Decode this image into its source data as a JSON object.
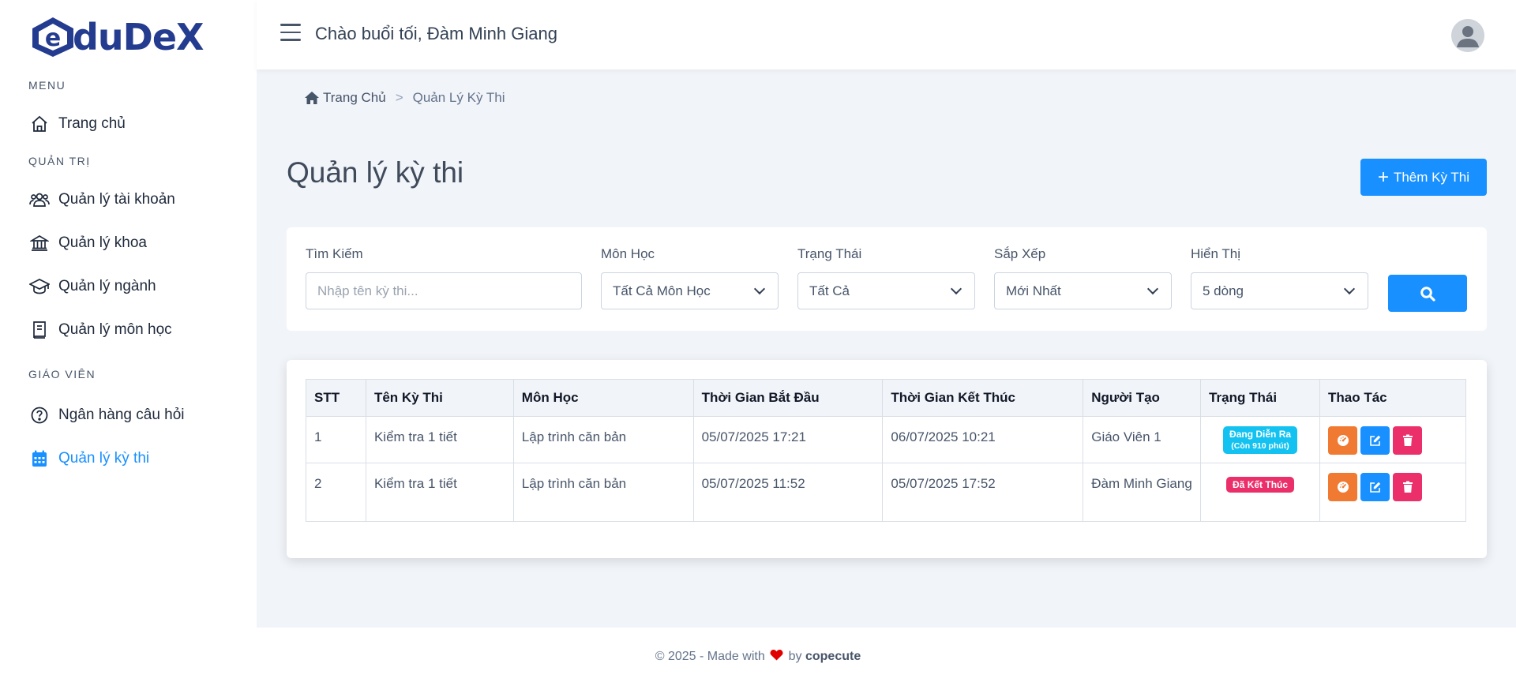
{
  "app": {
    "logo_text": "duDeX",
    "logo_full": "EduDeX"
  },
  "sidebar": {
    "sections": [
      {
        "title": "MENU"
      },
      {
        "title": "QUẢN TRỊ"
      },
      {
        "title": "GIÁO VIÊN"
      }
    ],
    "items": [
      {
        "label": "Trang chủ",
        "icon": "home-icon"
      },
      {
        "label": "Quản lý tài khoản",
        "icon": "users-icon"
      },
      {
        "label": "Quản lý khoa",
        "icon": "bank-icon"
      },
      {
        "label": "Quản lý ngành",
        "icon": "graduation-cap-icon"
      },
      {
        "label": "Quản lý môn học",
        "icon": "book-icon"
      },
      {
        "label": "Ngân hàng câu hỏi",
        "icon": "question-circle-icon"
      },
      {
        "label": "Quản lý kỳ thi",
        "icon": "calendar-icon",
        "active": true
      }
    ]
  },
  "header": {
    "greeting": "Chào buổi tối, Đàm Minh Giang"
  },
  "breadcrumb": {
    "home": "Trang Chủ",
    "separator": ">",
    "current": "Quản Lý Kỳ Thi"
  },
  "page": {
    "title": "Quản lý kỳ thi",
    "add_button": "Thêm Kỳ Thi"
  },
  "filters": {
    "search": {
      "label": "Tìm Kiếm",
      "placeholder": "Nhập tên kỳ thi..."
    },
    "subject": {
      "label": "Môn Học",
      "value": "Tất Cả Môn Học"
    },
    "status": {
      "label": "Trạng Thái",
      "value": "Tất Cả"
    },
    "sort": {
      "label": "Sắp Xếp",
      "value": "Mới Nhất"
    },
    "display": {
      "label": "Hiển Thị",
      "value": "5 dòng"
    }
  },
  "table": {
    "columns": [
      "STT",
      "Tên Kỳ Thi",
      "Môn Học",
      "Thời Gian Bắt Đầu",
      "Thời Gian Kết Thúc",
      "Người Tạo",
      "Trạng Thái",
      "Thao Tác"
    ],
    "rows": [
      {
        "stt": "1",
        "name": "Kiểm tra 1 tiết",
        "subject": "Lập trình căn bản",
        "start": "05/07/2025 17:21",
        "end": "06/07/2025 10:21",
        "creator": "Giáo Viên 1",
        "status_line1": "Đang Diễn Ra",
        "status_line2": "(Còn 910 phút)",
        "status_color": "#13c2f0"
      },
      {
        "stt": "2",
        "name": "Kiểm tra 1 tiết",
        "subject": "Lập trình căn bản",
        "start": "05/07/2025 11:52",
        "end": "05/07/2025 17:52",
        "creator": "Đàm Minh Giang",
        "status_line1": "Đã Kết Thúc",
        "status_color": "#eb2f6b"
      }
    ]
  },
  "footer": {
    "prefix": "© 2025 - Made with",
    "by": "by",
    "brand": "copecute"
  },
  "colors": {
    "primary": "#1890ff",
    "orange": "#f07a32",
    "pink": "#eb2f6b",
    "cyan": "#13c2f0",
    "logo": "#243c8f"
  }
}
